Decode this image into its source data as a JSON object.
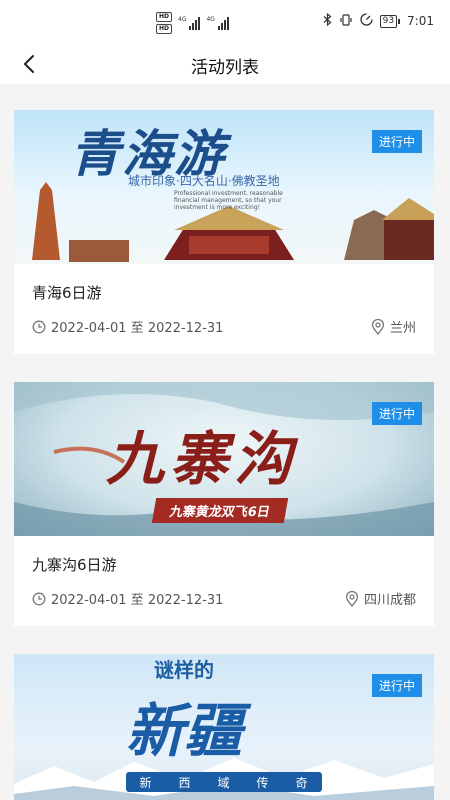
{
  "status_bar": {
    "hd1": "HD",
    "hd2": "HD",
    "net1": "4G",
    "net2": "4G",
    "battery": "93",
    "time": "7:01"
  },
  "nav": {
    "title": "活动列表"
  },
  "activities": [
    {
      "title": "青海6日游",
      "date": "2022-04-01 至 2022-12-31",
      "location": "兰州",
      "status": "进行中",
      "banner": {
        "calligraphy": "青海游",
        "slogan": "城市印象·四大名山·佛教圣地",
        "english": "Professional investment, reasonable financial management, so that your investment is more exciting!"
      }
    },
    {
      "title": "九寨沟6日游",
      "date": "2022-04-01 至 2022-12-31",
      "location": "四川成都",
      "status": "进行中",
      "banner": {
        "calligraphy": "九寨沟",
        "ribbon": "九寨黄龙双飞6日"
      }
    },
    {
      "status": "进行中",
      "banner": {
        "top": "谜样的",
        "calligraphy": "新疆",
        "strip": [
          "新",
          "西",
          "域",
          "传",
          "奇"
        ]
      }
    }
  ],
  "colors": {
    "badge": "#1f8ee8",
    "background": "#f4f4f4"
  }
}
